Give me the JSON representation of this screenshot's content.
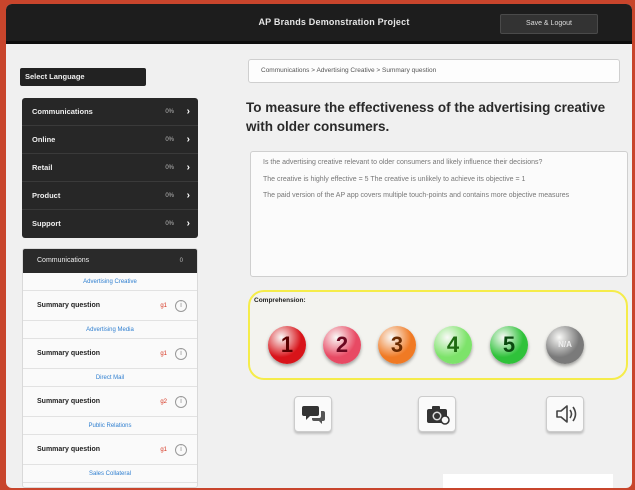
{
  "header": {
    "title": "AP Brands Demonstration Project",
    "save_label": "Save & Logout"
  },
  "sidebar": {
    "language_label": "Select Language",
    "categories": [
      {
        "label": "Communications",
        "pct": "0%"
      },
      {
        "label": "Online",
        "pct": "0%"
      },
      {
        "label": "Retail",
        "pct": "0%"
      },
      {
        "label": "Product",
        "pct": "0%"
      },
      {
        "label": "Support",
        "pct": "0%"
      }
    ],
    "section": {
      "title": "Communications",
      "pct": "0"
    },
    "groups": [
      {
        "label": "Advertising Creative",
        "question": "Summary question",
        "num": "g1"
      },
      {
        "label": "Advertising Media",
        "question": "Summary question",
        "num": "g1"
      },
      {
        "label": "Direct Mail",
        "question": "Summary question",
        "num": "g2"
      },
      {
        "label": "Public Relations",
        "question": "Summary question",
        "num": "g1"
      },
      {
        "label": "Sales Collateral"
      }
    ]
  },
  "main": {
    "breadcrumb": "Communications > Advertising Creative > Summary question",
    "question": "To measure the effectiveness of the advertising creative with older consumers.",
    "description": [
      "Is the advertising creative relevant to older consumers and likely influence their decisions?",
      "The creative is highly effective = 5 The creative is unlikely to achieve its objective = 1",
      "The paid version of the AP app covers multiple touch-points and contains more objective measures"
    ],
    "comprehension_label": "Comprehension:",
    "ratings": [
      {
        "label": "1",
        "color": "#d8141a",
        "text_color": "#5a0000"
      },
      {
        "label": "2",
        "color": "#e84a64",
        "text_color": "#6a0820"
      },
      {
        "label": "3",
        "color": "#f07a24",
        "text_color": "#6a2a00"
      },
      {
        "label": "4",
        "color": "#7de36a",
        "text_color": "#1e6a10"
      },
      {
        "label": "5",
        "color": "#2fc23a",
        "text_color": "#0b4a10"
      },
      {
        "label": "N/A",
        "color": "#7a7a7a",
        "text_color": "#eeeeee"
      }
    ],
    "actions": [
      {
        "icon": "comment-icon"
      },
      {
        "icon": "camera-icon"
      },
      {
        "icon": "speaker-icon"
      }
    ]
  }
}
